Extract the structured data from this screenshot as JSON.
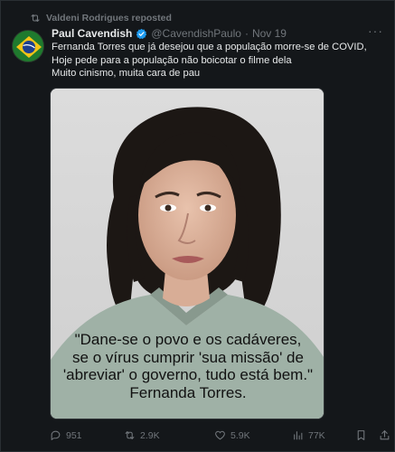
{
  "repost_line": "Valdeni Rodrigues reposted",
  "author": {
    "name": "Paul Cavendish",
    "handle": "@CavendishPaulo",
    "separator": "·",
    "date": "Nov 19"
  },
  "tweet_lines": [
    "Fernanda Torres que já desejou que a população morre-se de COVID, Hoje pede para a população não boicotar o filme dela",
    "Muito cinismo, muita cara de pau"
  ],
  "media": {
    "quote_lines": [
      "\"Dane-se o povo e os cadáveres,",
      "se o vírus cumprir 'sua missão' de",
      "'abreviar' o governo, tudo está bem.\"",
      "Fernanda Torres."
    ]
  },
  "actions": {
    "replies": "951",
    "reposts": "2.9K",
    "likes": "5.9K",
    "views": "77K"
  },
  "colors": {
    "background": "#14171a",
    "text": "#e7e9ea",
    "muted": "#71767b",
    "verified": "#1d9bf0"
  }
}
